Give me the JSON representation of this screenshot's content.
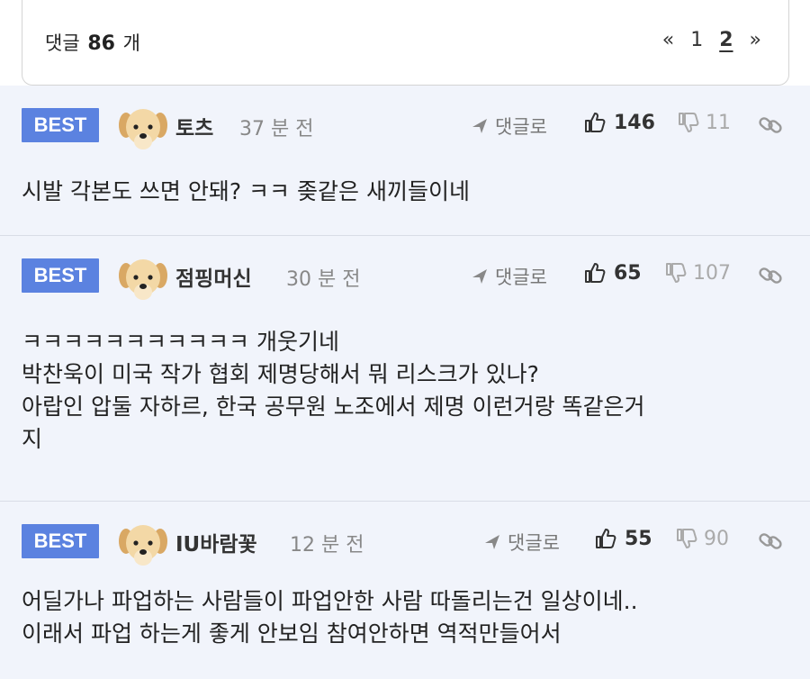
{
  "header": {
    "count_prefix": "댓글",
    "count_value": "86",
    "count_suffix": "개",
    "pager": {
      "prev": "«",
      "page1": "1",
      "page2": "2",
      "next": "»"
    }
  },
  "comments": [
    {
      "badge": "BEST",
      "nickname": "토츠",
      "time": "37 분 전",
      "reply_label": "댓글로",
      "likes": "146",
      "dislikes": "11",
      "text": "시발 각본도 쓰면 안돼? ㅋㅋ 좆같은 새끼들이네"
    },
    {
      "badge": "BEST",
      "nickname": "점핑머신",
      "time": "30 분 전",
      "reply_label": "댓글로",
      "likes": "65",
      "dislikes": "107",
      "text": "ㅋㅋㅋㅋㅋㅋㅋㅋㅋㅋㅋ 개웃기네\n박찬욱이 미국 작가 협회 제명당해서 뭐 리스크가 있나?\n아랍인 압둘 자하르, 한국 공무원 노조에서 제명 이런거랑 똑같은거\n지"
    },
    {
      "badge": "BEST",
      "nickname": "IU바람꽃",
      "time": "12 분 전",
      "reply_label": "댓글로",
      "likes": "55",
      "dislikes": "90",
      "text": "어딜가나 파업하는 사람들이 파업안한 사람 따돌리는건 일상이네..\n이래서 파업 하는게 좋게 안보임 참여안하면 역적만들어서"
    }
  ],
  "colors": {
    "best_badge": "#5b82e0",
    "comment_bg": "#f1f4fb"
  },
  "icons": [
    "dog-avatar-icon",
    "reply-arrow-icon",
    "thumbs-up-icon",
    "thumbs-down-icon",
    "link-icon"
  ]
}
